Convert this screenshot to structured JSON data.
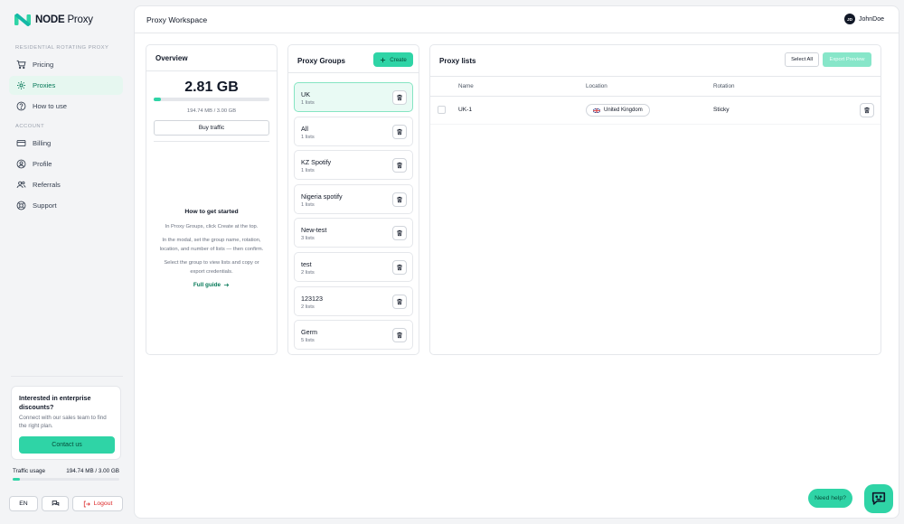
{
  "brand": {
    "name_bold": "NODE",
    "name_light": "Proxy"
  },
  "sidebar": {
    "section1": "RESIDENTIAL ROTATING PROXY",
    "section2": "ACCOUNT",
    "items": [
      {
        "label": "Pricing",
        "icon": "cart-icon"
      },
      {
        "label": "Proxies",
        "icon": "gear-icon",
        "active": true
      },
      {
        "label": "How to use",
        "icon": "help-circle-icon"
      },
      {
        "label": "Billing",
        "icon": "credit-card-icon"
      },
      {
        "label": "Profile",
        "icon": "user-circle-icon"
      },
      {
        "label": "Referrals",
        "icon": "users-icon"
      },
      {
        "label": "Support",
        "icon": "lifebuoy-icon"
      }
    ],
    "promo": {
      "title": "Interested in enterprise discounts?",
      "text": "Connect with our sales team to find the right plan.",
      "button": "Contact us"
    },
    "traffic": {
      "label": "Traffic usage",
      "value": "194.74 MB / 3.00 GB",
      "fraction": 0.065
    },
    "footer": {
      "lang": "EN",
      "logout": "Logout"
    }
  },
  "header": {
    "title": "Proxy Workspace",
    "user_initials": "JD",
    "user_name": "JohnDoe"
  },
  "overview": {
    "title": "Overview",
    "value": "2.81 GB",
    "fraction": 0.065,
    "sub": "194.74 MB / 3.00 GB",
    "buy_label": "Buy traffic",
    "help": {
      "title": "How to get started",
      "p1": "In Proxy Groups, click Create at the top.",
      "p2": "In the modal, set the group name, rotation, location, and number of lists — then confirm.",
      "p3": "Select the group to view lists and copy or export credentials.",
      "link": "Full guide"
    }
  },
  "groups": {
    "title": "Proxy Groups",
    "create_label": "Create",
    "items": [
      {
        "name": "UK",
        "count": "1 lists",
        "active": true
      },
      {
        "name": "All",
        "count": "1 lists"
      },
      {
        "name": "KZ Spotify",
        "count": "1 lists"
      },
      {
        "name": "Nigeria spotify",
        "count": "1 lists"
      },
      {
        "name": "New-test",
        "count": "3 lists"
      },
      {
        "name": "test",
        "count": "2 lists"
      },
      {
        "name": "123123",
        "count": "2 lists"
      },
      {
        "name": "Germ",
        "count": "5 lists"
      }
    ]
  },
  "lists": {
    "title": "Proxy lists",
    "select_all": "Select All",
    "export": "Export Preview",
    "columns": [
      "Name",
      "Location",
      "Rotation"
    ],
    "rows": [
      {
        "name": "UK-1",
        "location": "United Kingdom",
        "rotation": "Sticky"
      }
    ]
  },
  "help_widget": {
    "label": "Need help?"
  },
  "colors": {
    "accent": "#2fd4a6",
    "accent_dark": "#047857",
    "active_bg": "#e6f7f0"
  }
}
